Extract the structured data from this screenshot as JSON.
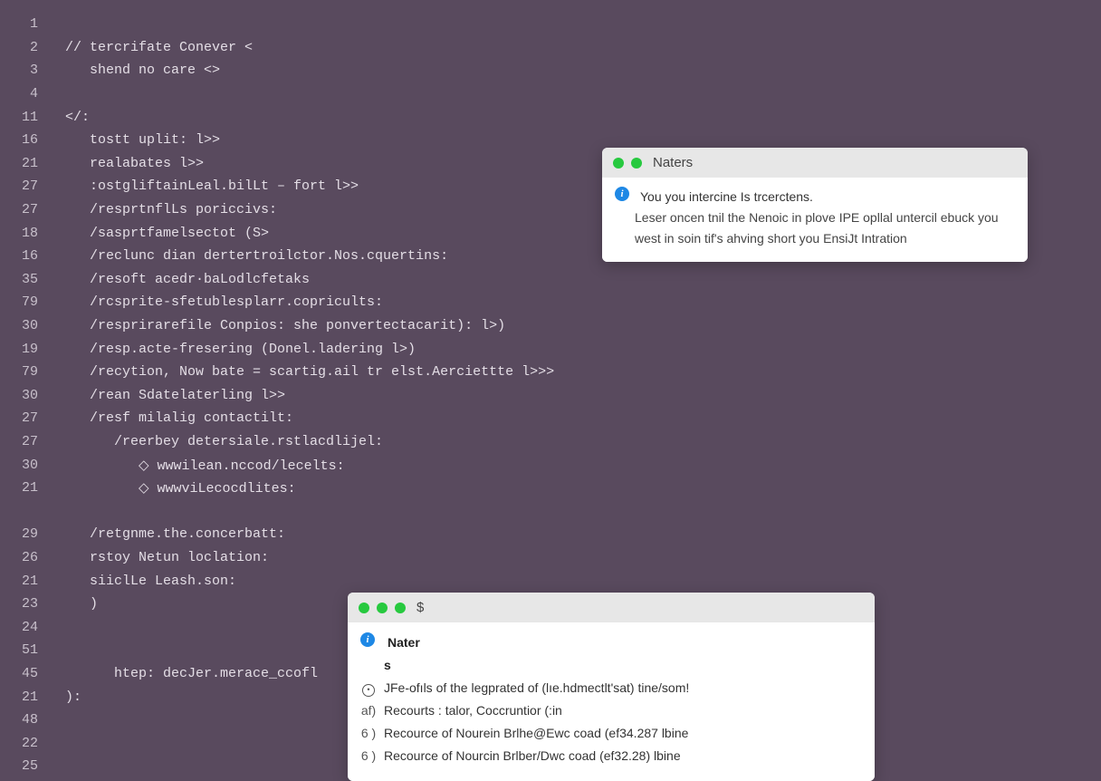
{
  "editor": {
    "lines": [
      {
        "num": "1",
        "indent": 0,
        "text": ""
      },
      {
        "num": "2",
        "indent": 0,
        "text": "// tercrifate Conever <"
      },
      {
        "num": "3",
        "indent": 1,
        "text": "shend no care <>"
      },
      {
        "num": "4",
        "indent": 0,
        "text": ""
      },
      {
        "num": "11",
        "indent": 0,
        "text": "</:"
      },
      {
        "num": "16",
        "indent": 1,
        "text": "tostt uplit: l>>"
      },
      {
        "num": "21",
        "indent": 1,
        "text": "realabates l>>"
      },
      {
        "num": "27",
        "indent": 1,
        "text": ":ostgliftainLeal.bilLt – fort l>>"
      },
      {
        "num": "27",
        "indent": 1,
        "text": "/resprtnflLs poriccivs:"
      },
      {
        "num": "18",
        "indent": 1,
        "text": "/sasprtfamelsectot (S>"
      },
      {
        "num": "16",
        "indent": 1,
        "text": "/reclunc dian dertertroilctor.Nos.cquertins:"
      },
      {
        "num": "35",
        "indent": 1,
        "text": "/resoft acedr·baLodlcfetaks"
      },
      {
        "num": "79",
        "indent": 1,
        "text": "/rcsprite-sfetublesplarr.copricults:"
      },
      {
        "num": "30",
        "indent": 1,
        "text": "/resprirarefile Conpios: she ponvertectacarit): l>)"
      },
      {
        "num": "19",
        "indent": 1,
        "text": "/resp.acte-fresering (Donel.ladering l>)"
      },
      {
        "num": "79",
        "indent": 1,
        "text": "/recytion, Now bate = scartig.ail tr elst.Aerciettte l>>>"
      },
      {
        "num": "30",
        "indent": 1,
        "text": "/rean Sdatelaterling l>>"
      },
      {
        "num": "27",
        "indent": 1,
        "text": "/resf milalig contactilt:"
      },
      {
        "num": "27",
        "indent": 2,
        "text": "/reerbey detersiale.rstlacdlijel:"
      },
      {
        "num": "30",
        "indent": 3,
        "text": "◇ wwwilean.nccod/lecelts:"
      },
      {
        "num": "21",
        "indent": 3,
        "text": "◇ wwwviLecocdlites:"
      },
      {
        "num": "",
        "indent": 0,
        "text": ""
      },
      {
        "num": "29",
        "indent": 1,
        "text": "/retgnme.the.concerbatt:"
      },
      {
        "num": "26",
        "indent": 1,
        "text": "rstoy Netun loclation:"
      },
      {
        "num": "21",
        "indent": 1,
        "text": "siiclLe Leash.son:"
      },
      {
        "num": "23",
        "indent": 1,
        "text": ")"
      },
      {
        "num": "24",
        "indent": 0,
        "text": ""
      },
      {
        "num": "51",
        "indent": 0,
        "text": ""
      },
      {
        "num": "45",
        "indent": 2,
        "text": "htep: decJer.merace_ccofl"
      },
      {
        "num": "21",
        "indent": 0,
        "text": "):"
      },
      {
        "num": "48",
        "indent": 0,
        "text": ""
      },
      {
        "num": "22",
        "indent": 0,
        "text": ""
      },
      {
        "num": "25",
        "indent": 0,
        "text": ""
      }
    ]
  },
  "popup1": {
    "title": "Naters",
    "line1": "You you intercine Is trcerctens.",
    "line2": "Leser oncen tnil the Nenoic in plove IPE opllal untercil ebuck you west in soin tif's  ahving short you EnsiJt Intration"
  },
  "popup2": {
    "prompt": "$",
    "head": "Nater",
    "head2": "s",
    "l1_mark": "⊙",
    "l1": "JFe-ofıls of the legprated of (lıe.hdmectlt'sat) tine/som!",
    "l2_mark": "af)",
    "l2": "Recourts : talor, Coccruntior (:in",
    "l3_mark": "6 )",
    "l3": "Recource of Nourein Brlhe@Ewc coad (ef34.287 lbine",
    "l4_mark": "6 )",
    "l4": "Recource of Nourcin Brlber/Dwc coad (ef32.28) lbine"
  }
}
